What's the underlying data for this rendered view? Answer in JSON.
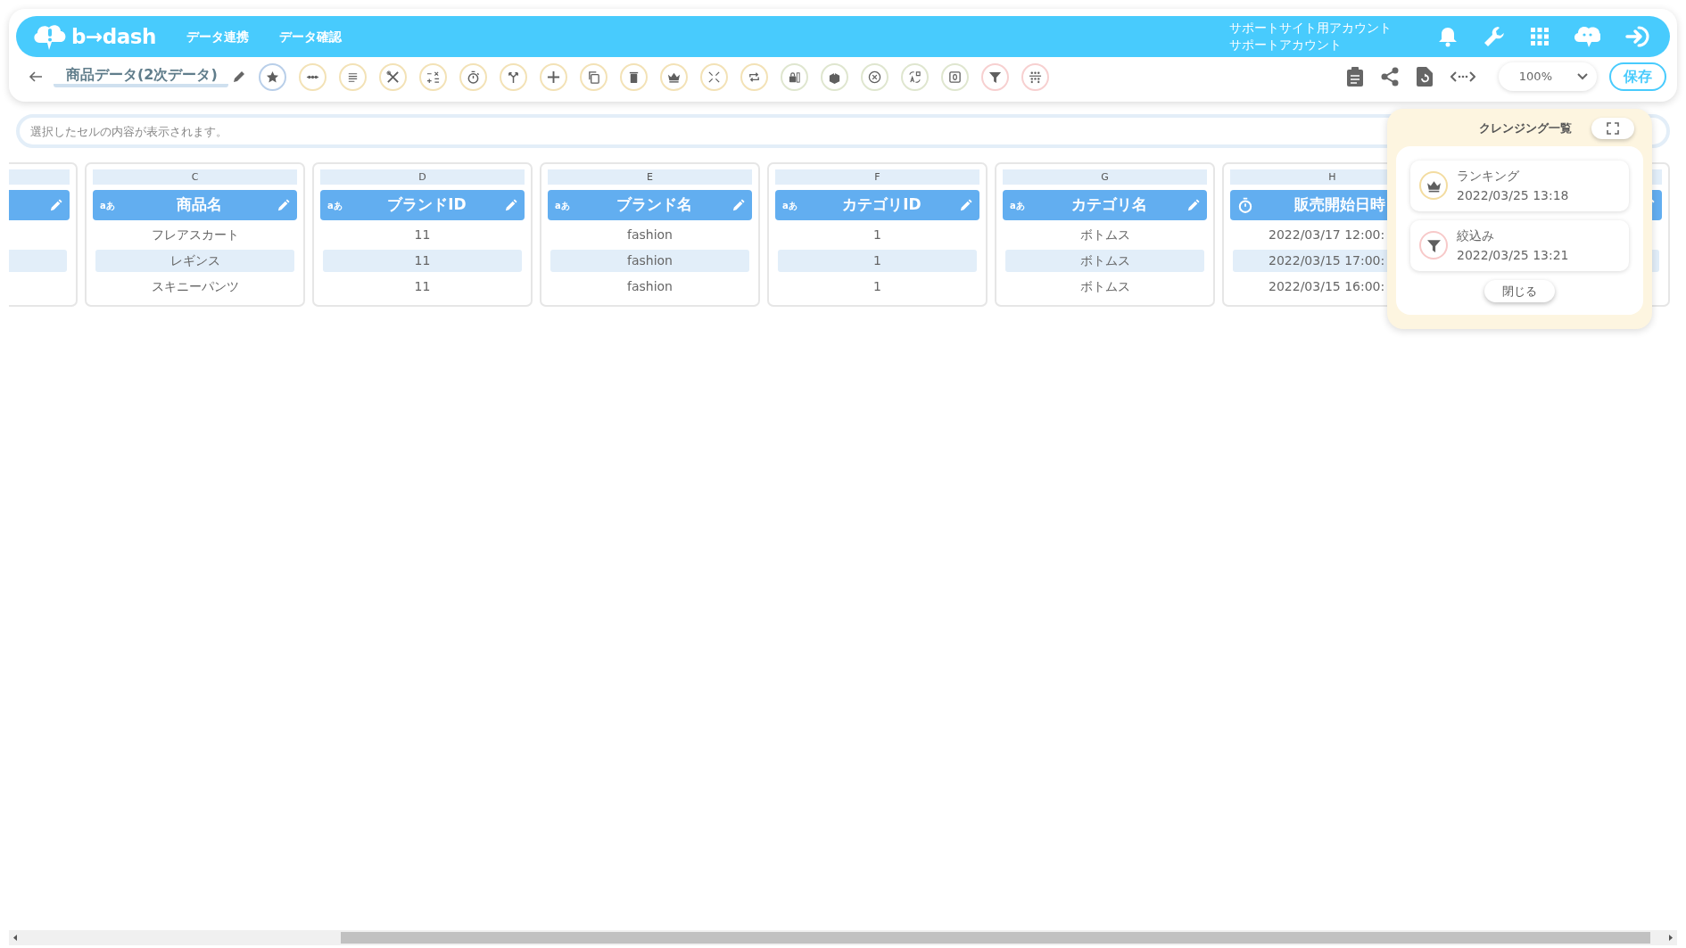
{
  "app": {
    "logo": "b→dash",
    "nav": [
      {
        "label": "データ連携"
      },
      {
        "label": "データ確認"
      }
    ],
    "account": {
      "site": "サポートサイト用アカウント",
      "user": "サポートアカウント"
    }
  },
  "toolbar": {
    "title": "商品データ(2次データ)",
    "tools": [
      {
        "kind": "star",
        "color": "#b9cfe9"
      },
      {
        "kind": "ellipsis",
        "color": "#f3e2b6"
      },
      {
        "kind": "lines",
        "color": "#f3e2b6"
      },
      {
        "kind": "tools",
        "color": "#f3e2b6"
      },
      {
        "kind": "calc",
        "color": "#f3e2b6"
      },
      {
        "kind": "stopwatch",
        "color": "#f3e2b6"
      },
      {
        "kind": "branch",
        "color": "#f3e2b6"
      },
      {
        "kind": "plus",
        "color": "#f3e2b6"
      },
      {
        "kind": "copy",
        "color": "#f3e2b6"
      },
      {
        "kind": "trash",
        "color": "#f3e2b6"
      },
      {
        "kind": "crown",
        "color": "#f3e2b6"
      },
      {
        "kind": "compress",
        "color": "#f3e2b6"
      },
      {
        "kind": "repeat",
        "color": "#f3e2b6"
      },
      {
        "kind": "lock",
        "color": "#dfe6cf"
      },
      {
        "kind": "box",
        "color": "#dfe6cf"
      },
      {
        "kind": "xcircle",
        "color": "#dfe6cf"
      },
      {
        "kind": "translate",
        "color": "#dfe6cf"
      },
      {
        "kind": "zero",
        "color": "#dfe6cf"
      },
      {
        "kind": "filter",
        "color": "#f7d0d0"
      },
      {
        "kind": "group",
        "color": "#f7d0d0"
      }
    ],
    "zoom": "100%",
    "save": "保存"
  },
  "cell_field": {
    "placeholder": "選択したセルの内容が表示されます。"
  },
  "columns": [
    {
      "kind": "text"
    },
    {
      "letter": "C",
      "name": "商品名",
      "kind": "text",
      "type_label": "aあ",
      "cells": [
        "フレアスカート",
        "レギンス",
        "スキニーパンツ"
      ]
    },
    {
      "letter": "D",
      "name": "ブランドID",
      "kind": "text",
      "type_label": "aあ",
      "cells": [
        "11",
        "11",
        "11"
      ]
    },
    {
      "letter": "E",
      "name": "ブランド名",
      "kind": "text",
      "type_label": "aあ",
      "cells": [
        "fashion",
        "fashion",
        "fashion"
      ]
    },
    {
      "letter": "F",
      "name": "カテゴリID",
      "kind": "text",
      "type_label": "aあ",
      "cells": [
        "1",
        "1",
        "1"
      ]
    },
    {
      "letter": "G",
      "name": "カテゴリ名",
      "kind": "text",
      "type_label": "aあ",
      "cells": [
        "ボトムス",
        "ボトムス",
        "ボトムス"
      ]
    },
    {
      "letter": "H",
      "name": "販売開始日時",
      "kind": "datetime",
      "cells": [
        "2022/03/17 12:00:",
        "2022/03/15 17:00:",
        "2022/03/15 16:00:"
      ]
    },
    {
      "kind": "text"
    }
  ],
  "cleansing_panel": {
    "title": "クレンジング一覧",
    "items": [
      {
        "kind": "ranking",
        "name": "ランキング",
        "time": "2022/03/25 13:18"
      },
      {
        "kind": "filter",
        "name": "絞込み",
        "time": "2022/03/25 13:21"
      }
    ],
    "close": "閉じる"
  }
}
